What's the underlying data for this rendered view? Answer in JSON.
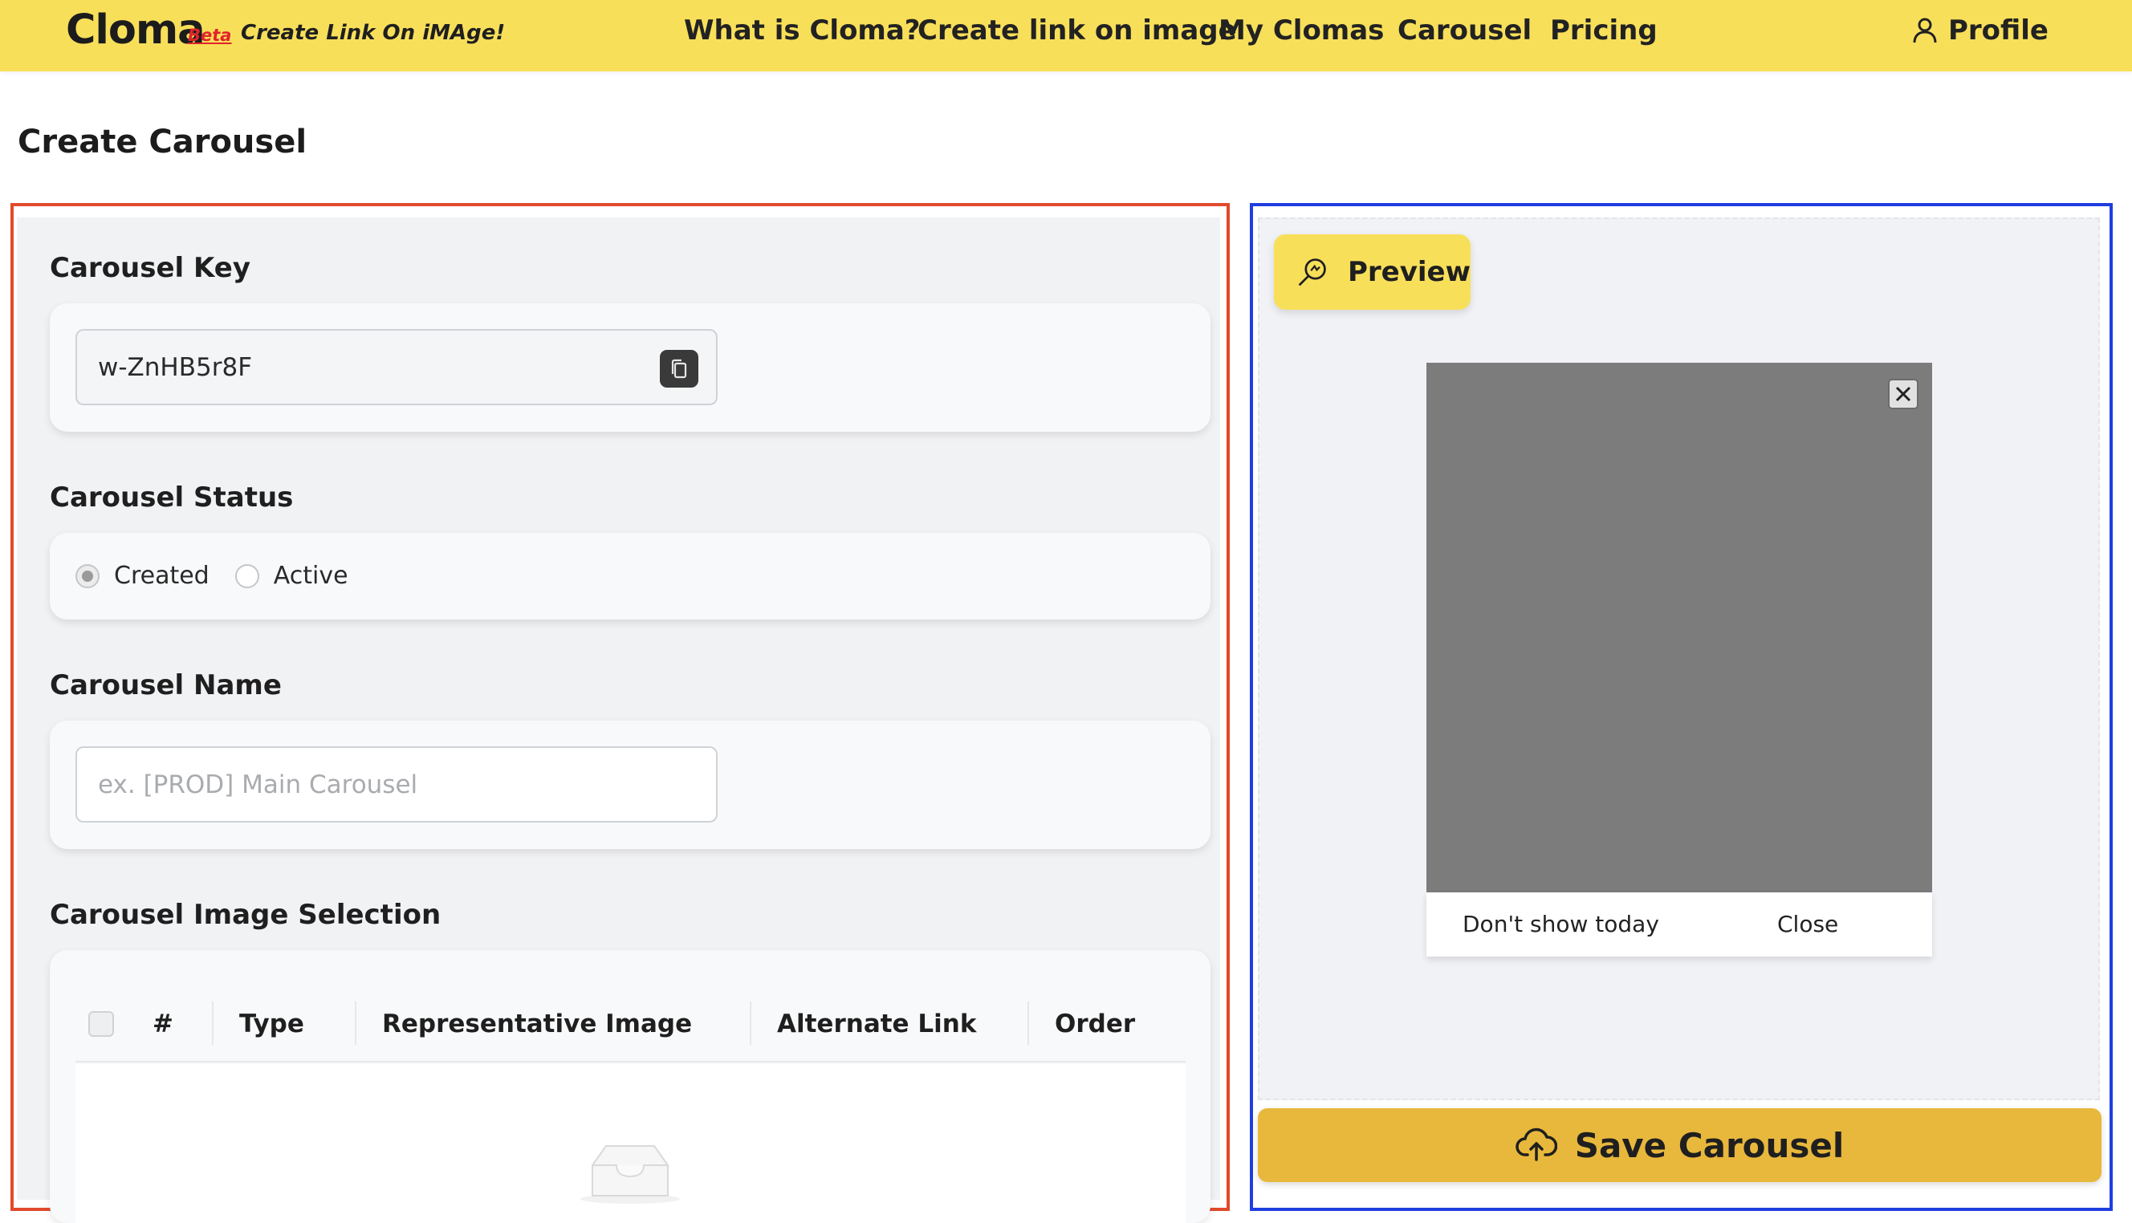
{
  "header": {
    "logo": "Cloma",
    "beta": "Beta",
    "tagline": "Create Link On iMAge!",
    "nav": [
      {
        "label": "What is Cloma?"
      },
      {
        "label": "Create link on image"
      },
      {
        "label": "My Clomas"
      },
      {
        "label": "Carousel"
      },
      {
        "label": "Pricing"
      }
    ],
    "profile_label": "Profile",
    "brand_color": "#f8df5a"
  },
  "page_title": "Create Carousel",
  "form": {
    "key": {
      "label": "Carousel Key",
      "value": "w-ZnHB5r8F",
      "copy_icon": "copy-icon"
    },
    "status": {
      "label": "Carousel Status",
      "options": [
        "Created",
        "Active"
      ],
      "selected": "Created"
    },
    "name": {
      "label": "Carousel Name",
      "placeholder": "ex. [PROD] Main Carousel",
      "value": ""
    },
    "images": {
      "label": "Carousel Image Selection",
      "columns": [
        "#",
        "Type",
        "Representative Image",
        "Alternate Link",
        "Order"
      ],
      "rows": [],
      "empty_icon": "inbox-icon"
    }
  },
  "preview": {
    "button_label": "Preview",
    "button_icon": "search-icon",
    "modal": {
      "image_color": "#7d7c7d",
      "close_icon": "close-icon",
      "dont_show_label": "Don't show today",
      "close_label": "Close"
    }
  },
  "save": {
    "label": "Save Carousel",
    "icon": "cloud-upload-icon",
    "color": "#e8b83c"
  },
  "annotations": {
    "left_frame_color": "#e14a2c",
    "right_frame_color": "#1f3ee0"
  }
}
